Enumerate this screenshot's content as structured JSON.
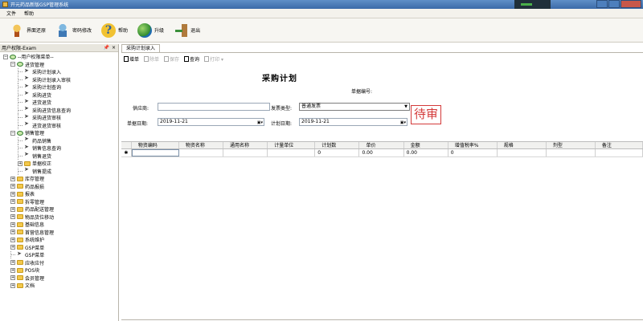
{
  "window": {
    "title": "开元药品新版GSP管理系统"
  },
  "menu": {
    "items": [
      "文件",
      "帮助"
    ]
  },
  "toolbar": {
    "buttons": [
      {
        "label": "界面还原",
        "icon": "restore-chair-icon"
      },
      {
        "label": "密码修改",
        "icon": "user-key-icon"
      },
      {
        "label": "帮助",
        "icon": "help-icon"
      },
      {
        "label": "升级",
        "icon": "globe-icon"
      },
      {
        "label": "退出",
        "icon": "exit-door-icon"
      }
    ]
  },
  "left_panel": {
    "header": "用户权限-Exam",
    "pin": "📌",
    "close": "×",
    "tree": [
      {
        "label": "--用户权限菜单--",
        "level": 0,
        "expander": "⊟",
        "icon": "tick"
      },
      {
        "label": "进货管理",
        "level": 1,
        "expander": "⊟",
        "icon": "tick"
      },
      {
        "label": "采购计划录入",
        "level": 2,
        "icon": "arrow"
      },
      {
        "label": "采购计划录入审核",
        "level": 2,
        "icon": "arrow"
      },
      {
        "label": "采购计划查询",
        "level": 2,
        "icon": "arrow"
      },
      {
        "label": "采购进货",
        "level": 2,
        "icon": "arrow"
      },
      {
        "label": "进货退货",
        "level": 2,
        "icon": "arrow"
      },
      {
        "label": "采购进货信息查询",
        "level": 2,
        "icon": "arrow"
      },
      {
        "label": "采购进货审核",
        "level": 2,
        "icon": "arrow"
      },
      {
        "label": "进货退货审核",
        "level": 2,
        "icon": "arrow"
      },
      {
        "label": "销售管理",
        "level": 1,
        "expander": "⊟",
        "icon": "tick"
      },
      {
        "label": "药品销售",
        "level": 2,
        "icon": "arrow"
      },
      {
        "label": "销售信息查询",
        "level": 2,
        "icon": "arrow"
      },
      {
        "label": "销售退货",
        "level": 2,
        "icon": "arrow"
      },
      {
        "label": "单据校正",
        "level": 2,
        "expander": "⊞",
        "icon": "folder"
      },
      {
        "label": "销售提成",
        "level": 2,
        "icon": "arrow"
      },
      {
        "label": "库存管理",
        "level": 1,
        "expander": "⊞",
        "icon": "folder"
      },
      {
        "label": "药品报损",
        "level": 1,
        "expander": "⊞",
        "icon": "folder"
      },
      {
        "label": "报表",
        "level": 1,
        "expander": "⊞",
        "icon": "folder"
      },
      {
        "label": "拆零管理",
        "level": 1,
        "expander": "⊞",
        "icon": "folder"
      },
      {
        "label": "药品配送管理",
        "level": 1,
        "expander": "⊞",
        "icon": "folder"
      },
      {
        "label": "物品货位移动",
        "level": 1,
        "expander": "⊞",
        "icon": "folder"
      },
      {
        "label": "基础信息",
        "level": 1,
        "expander": "⊞",
        "icon": "folder"
      },
      {
        "label": "首营信息管理",
        "level": 1,
        "expander": "⊞",
        "icon": "folder"
      },
      {
        "label": "系统维护",
        "level": 1,
        "expander": "⊞",
        "icon": "folder"
      },
      {
        "label": "GSP菜单",
        "level": 1,
        "expander": "⊞",
        "icon": "folder"
      },
      {
        "label": "GSP菜单",
        "level": 1,
        "icon": "arrow"
      },
      {
        "label": "应收应付",
        "level": 1,
        "expander": "⊞",
        "icon": "folder"
      },
      {
        "label": "POS块",
        "level": 1,
        "expander": "⊞",
        "icon": "folder"
      },
      {
        "label": "会员管理",
        "level": 1,
        "expander": "⊞",
        "icon": "folder"
      },
      {
        "label": "文档",
        "level": 1,
        "expander": "⊞",
        "icon": "folder"
      }
    ]
  },
  "document": {
    "tab": "采购计划录入",
    "sub_toolbar": [
      {
        "label": "增单",
        "enabled": true
      },
      {
        "label": "除单",
        "enabled": false
      },
      {
        "label": "保存",
        "enabled": false
      },
      {
        "label": "查询",
        "enabled": true
      },
      {
        "label": "打印 ▾",
        "enabled": false
      }
    ],
    "form_title": "采购计划",
    "doc_no_label": "单据编号:",
    "supplier_label": "供应商:",
    "supplier_value": "",
    "invoice_type_label": "发票类型:",
    "invoice_type_value": "普通发票",
    "doc_date_label": "单据日期:",
    "doc_date_value": "2019-11-21",
    "plan_date_label": "计划日期:",
    "plan_date_value": "2019-11-21",
    "stamp": "待审",
    "grid": {
      "columns": [
        "物资编码",
        "物资名称",
        "通用名称",
        "计量单位",
        "计划数",
        "单价",
        "金额",
        "增值税率%",
        "规格",
        "剂型",
        "备注"
      ],
      "rows": [
        {
          "marker": "✱",
          "cells": [
            "",
            "",
            "",
            "",
            "0",
            "0.00",
            "0.00",
            "0",
            "",
            "",
            ""
          ]
        }
      ]
    }
  }
}
